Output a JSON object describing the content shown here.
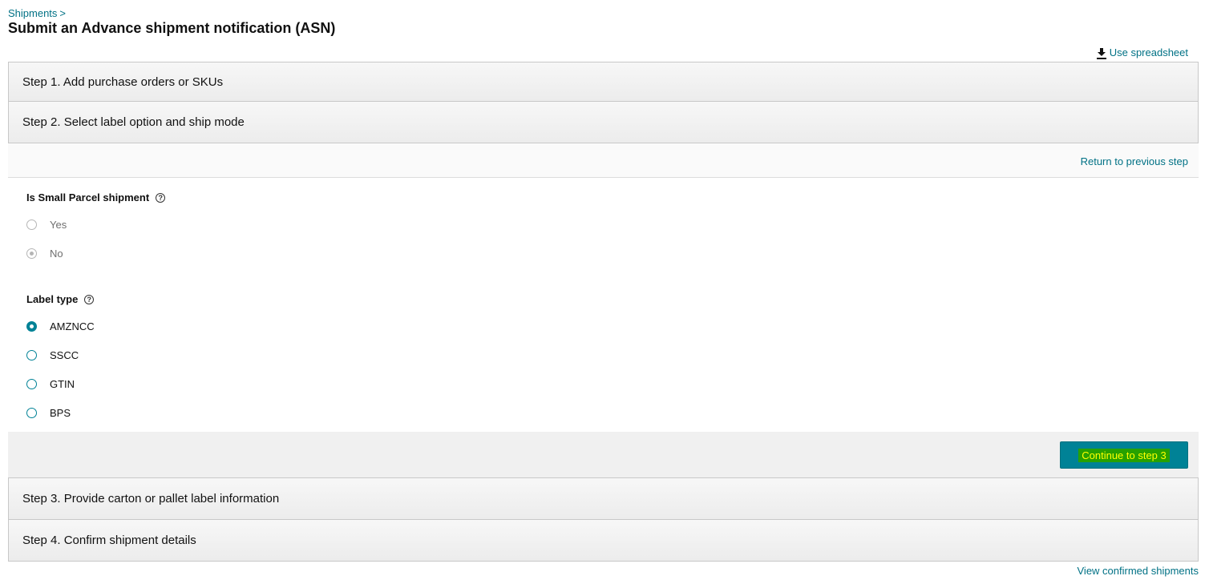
{
  "breadcrumb": {
    "shipments": "Shipments",
    "separator": ">"
  },
  "page_title": "Submit an Advance shipment notification (ASN)",
  "use_spreadsheet": {
    "label": "Use spreadsheet",
    "icon": "download-icon"
  },
  "steps": {
    "step1": "Step 1. Add purchase orders or SKUs",
    "step2": "Step 2. Select label option and ship mode",
    "step3": "Step 3. Provide carton or pallet label information",
    "step4": "Step 4. Confirm shipment details"
  },
  "step2": {
    "return_link": "Return to previous step",
    "small_parcel": {
      "label": "Is Small Parcel shipment",
      "help_icon": "?",
      "options": [
        {
          "label": "Yes",
          "selected": false,
          "disabled": true
        },
        {
          "label": "No",
          "selected": true,
          "disabled": true
        }
      ]
    },
    "label_type": {
      "label": "Label type",
      "help_icon": "?",
      "options": [
        {
          "label": "AMZNCC",
          "selected": true
        },
        {
          "label": "SSCC",
          "selected": false
        },
        {
          "label": "GTIN",
          "selected": false
        },
        {
          "label": "BPS",
          "selected": false
        }
      ]
    },
    "continue_button": "Continue to step 3"
  },
  "footer": {
    "view_confirmed": "View confirmed shipments"
  },
  "colors": {
    "link": "#007185",
    "primary_button": "#008296",
    "highlight_bg": "#27a100",
    "highlight_text": "#ffff00"
  }
}
